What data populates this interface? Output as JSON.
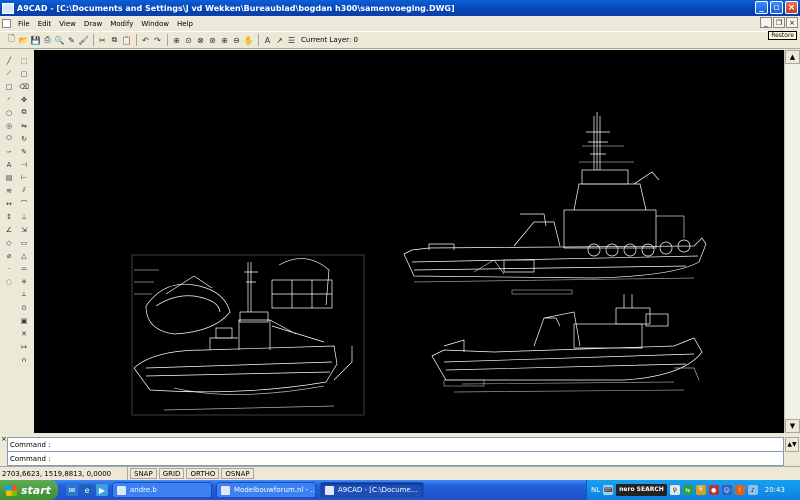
{
  "window": {
    "title": "A9CAD - [C:\\Documents and Settings\\J vd Wekken\\Bureaublad\\bogdan h300\\samenvoeging.DWG]",
    "restore_tooltip": "Restore"
  },
  "menu": [
    "File",
    "Edit",
    "View",
    "Draw",
    "Modify",
    "Window",
    "Help"
  ],
  "toolbar": {
    "current_layer_label": "Current Layer: 0",
    "icons": [
      "new-icon",
      "open-icon",
      "save-icon",
      "print-icon",
      "print-preview-icon",
      "pen-icon",
      "brush-icon",
      "cut-icon",
      "copy-icon",
      "paste-icon",
      "undo-icon",
      "redo-icon",
      "zoom-window-icon",
      "zoom-in-icon",
      "zoom-extents-icon",
      "zoom-all-icon",
      "zoom-plus-icon",
      "zoom-minus-icon",
      "pan-icon",
      "text-style-icon",
      "fit-icon",
      "layer-icon"
    ]
  },
  "command": {
    "close_symbol": "×",
    "line1": "Command :",
    "line2": "Command :"
  },
  "status": {
    "coords": "2703,6623, 1519,8813, 0,0000",
    "toggles": [
      "SNAP",
      "GRID",
      "ORTHO",
      "OSNAP"
    ]
  },
  "taskbar": {
    "start_label": "start",
    "buttons": [
      {
        "label": "andre.b",
        "active": false
      },
      {
        "label": "Modelbouwforum.nl - ...",
        "active": false
      },
      {
        "label": "A9CAD - [C:\\Docume...",
        "active": true
      }
    ],
    "tray": {
      "lang": "NL",
      "nero_label": "nero SEARCH",
      "time": "20:43"
    }
  },
  "colors": {
    "canvas": "#000000",
    "drawing_lines": "#ffffff",
    "titlebar": "#0a50c8"
  }
}
